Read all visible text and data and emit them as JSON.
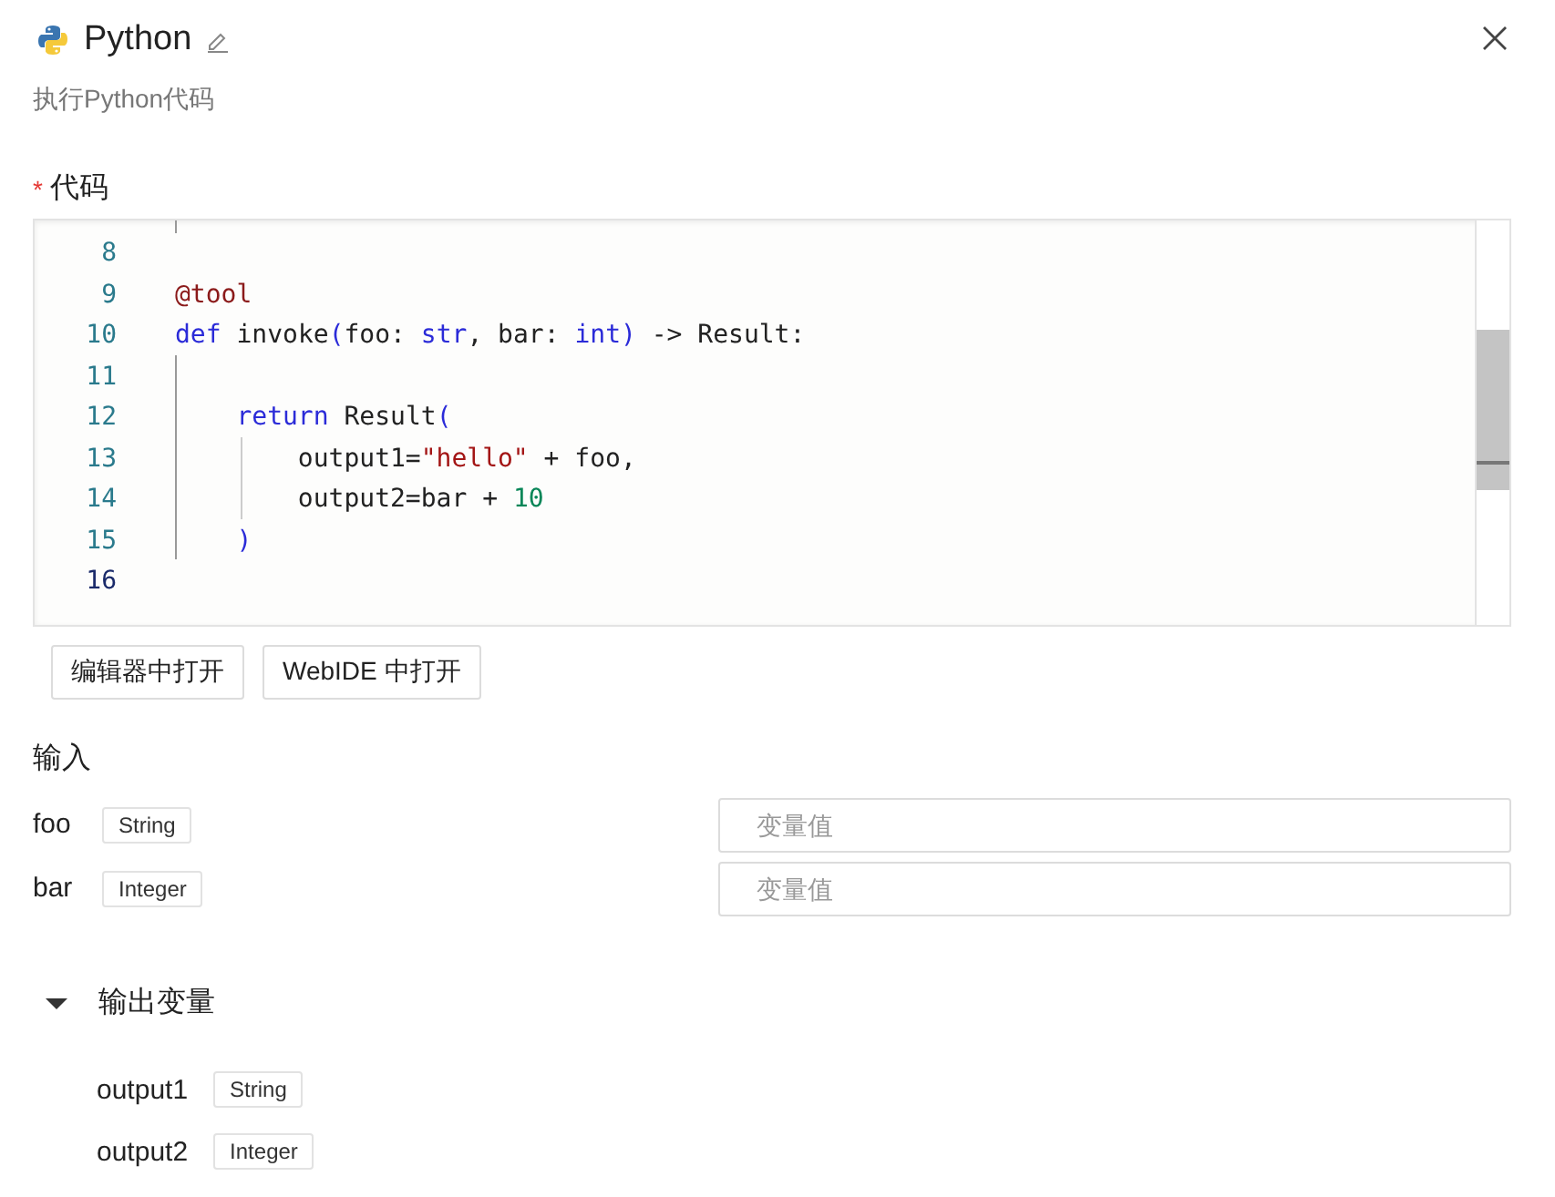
{
  "header": {
    "title": "Python",
    "description": "执行Python代码"
  },
  "code_section": {
    "required_mark": "*",
    "label": "代码",
    "lines": [
      {
        "number": "8",
        "current": false
      },
      {
        "number": "9",
        "current": false,
        "tokens": [
          {
            "kind": "decorator",
            "text": "@tool"
          }
        ]
      },
      {
        "number": "10",
        "current": false,
        "tokens": [
          {
            "kind": "keyword",
            "text": "def"
          },
          {
            "kind": "plain",
            "text": " invoke"
          },
          {
            "kind": "bracket",
            "text": "("
          },
          {
            "kind": "plain",
            "text": "foo: "
          },
          {
            "kind": "keyword",
            "text": "str"
          },
          {
            "kind": "plain",
            "text": ", bar: "
          },
          {
            "kind": "keyword",
            "text": "int"
          },
          {
            "kind": "bracket",
            "text": ")"
          },
          {
            "kind": "plain",
            "text": " -> Result:"
          }
        ]
      },
      {
        "number": "11",
        "current": false
      },
      {
        "number": "12",
        "current": false,
        "tokens": [
          {
            "kind": "keyword",
            "text": "    return"
          },
          {
            "kind": "plain",
            "text": " Result"
          },
          {
            "kind": "bracket",
            "text": "("
          }
        ]
      },
      {
        "number": "13",
        "current": false,
        "tokens": [
          {
            "kind": "plain",
            "text": "        output1="
          },
          {
            "kind": "string",
            "text": "\"hello\""
          },
          {
            "kind": "plain",
            "text": " + foo,"
          }
        ]
      },
      {
        "number": "14",
        "current": false,
        "tokens": [
          {
            "kind": "plain",
            "text": "        output2=bar + "
          },
          {
            "kind": "number",
            "text": "10"
          }
        ]
      },
      {
        "number": "15",
        "current": false,
        "tokens": [
          {
            "kind": "bracket",
            "text": "    )"
          }
        ]
      },
      {
        "number": "16",
        "current": true
      }
    ],
    "buttons": [
      "编辑器中打开",
      "WebIDE 中打开"
    ]
  },
  "inputs": {
    "label": "输入",
    "rows": [
      {
        "name": "foo",
        "type": "String",
        "placeholder": "变量值"
      },
      {
        "name": "bar",
        "type": "Integer",
        "placeholder": "变量值"
      }
    ]
  },
  "outputs": {
    "label": "输出变量",
    "expanded": true,
    "rows": [
      {
        "name": "output1",
        "type": "String"
      },
      {
        "name": "output2",
        "type": "Integer"
      }
    ]
  }
}
